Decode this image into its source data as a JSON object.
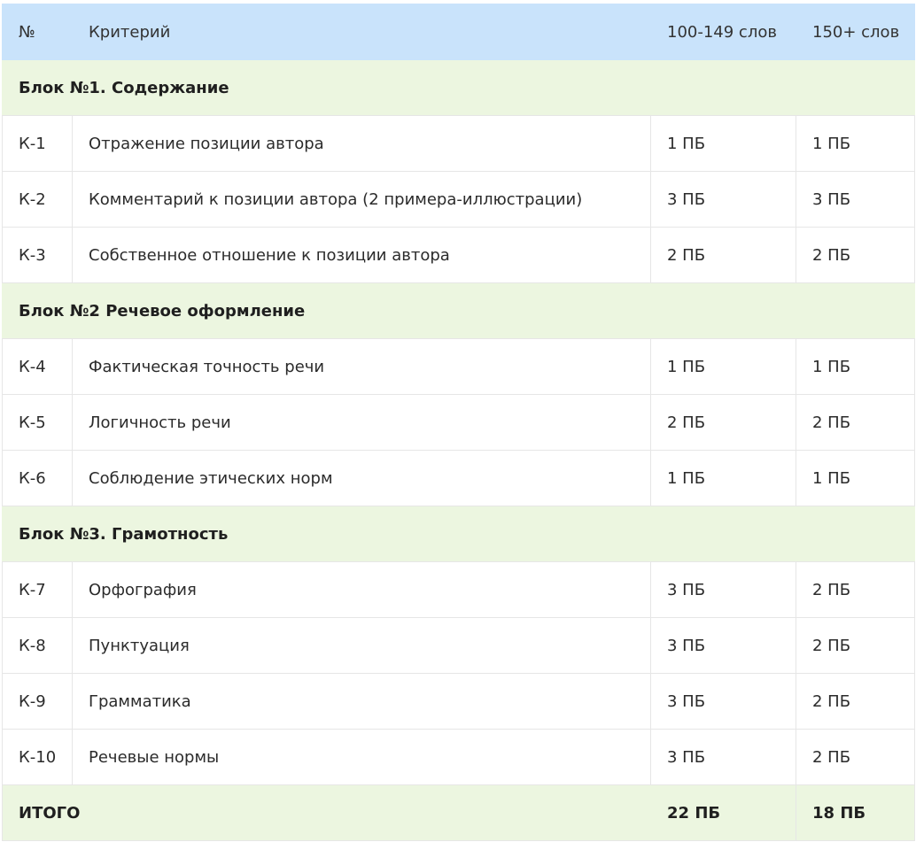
{
  "header": {
    "num": "№",
    "criterion": "Критерий",
    "col_a": "100-149 слов",
    "col_b": "150+ слов"
  },
  "blocks": [
    {
      "title": "Блок №1. Содержание",
      "rows": [
        {
          "id": "К-1",
          "name": "Отражение позиции автора",
          "a": "1 ПБ",
          "b": "1 ПБ"
        },
        {
          "id": "К-2",
          "name": "Комментарий к позиции автора (2 примера-иллюстрации)",
          "a": "3 ПБ",
          "b": "3 ПБ"
        },
        {
          "id": "К-3",
          "name": "Собственное отношение к позиции автора",
          "a": "2 ПБ",
          "b": "2 ПБ"
        }
      ]
    },
    {
      "title": "Блок №2 Речевое оформление",
      "rows": [
        {
          "id": "К-4",
          "name": "Фактическая точность речи",
          "a": "1 ПБ",
          "b": "1 ПБ"
        },
        {
          "id": "К-5",
          "name": "Логичность речи",
          "a": "2 ПБ",
          "b": "2 ПБ"
        },
        {
          "id": "К-6",
          "name": "Соблюдение этических норм",
          "a": "1 ПБ",
          "b": "1 ПБ"
        }
      ]
    },
    {
      "title": "Блок №3. Грамотность",
      "rows": [
        {
          "id": "К-7",
          "name": "Орфография",
          "a": "3 ПБ",
          "b": "2 ПБ"
        },
        {
          "id": "К-8",
          "name": "Пунктуация",
          "a": "3 ПБ",
          "b": "2 ПБ"
        },
        {
          "id": "К-9",
          "name": "Грамматика",
          "a": "3 ПБ",
          "b": "2 ПБ"
        },
        {
          "id": "К-10",
          "name": "Речевые нормы",
          "a": "3 ПБ",
          "b": "2 ПБ"
        }
      ]
    }
  ],
  "total": {
    "label": "ИТОГО",
    "a": "22 ПБ",
    "b": "18 ПБ"
  }
}
